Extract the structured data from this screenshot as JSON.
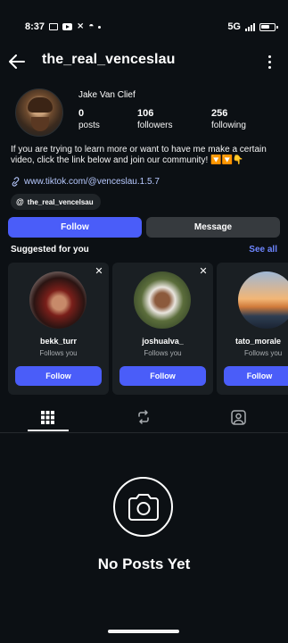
{
  "status_bar": {
    "time": "8:37",
    "network": "5G",
    "icons": [
      "notification-icon",
      "youtube-icon",
      "capcut-icon",
      "threads-icon",
      "dot-icon",
      "signal-icon",
      "battery-icon"
    ]
  },
  "header": {
    "username": "the_real_venceslau",
    "back_icon": "back-arrow-icon",
    "more_icon": "more-vertical-icon"
  },
  "profile": {
    "display_name": "Jake Van Clief",
    "stats": [
      {
        "value": "0",
        "label": "posts"
      },
      {
        "value": "106",
        "label": "followers"
      },
      {
        "value": "256",
        "label": "following"
      }
    ],
    "bio": "If you are trying to learn more or want to have me make a certain video, click the link below and join our community! 🔽🔽👇",
    "link": "www.tiktok.com/@venceslau.1.5.7",
    "threads_handle": "the_real_vencelsau"
  },
  "actions": {
    "follow_label": "Follow",
    "message_label": "Message"
  },
  "suggested": {
    "title": "Suggested for you",
    "see_all": "See all",
    "cards": [
      {
        "name": "bekk_turr",
        "subtitle": "Follows you",
        "button": "Follow"
      },
      {
        "name": "joshualva_",
        "subtitle": "Follows you",
        "button": "Follow"
      },
      {
        "name": "tato_morale",
        "subtitle": "Follows you",
        "button": "Follow"
      }
    ]
  },
  "tabs": [
    {
      "name": "grid",
      "icon": "grid-icon",
      "active": true
    },
    {
      "name": "reels",
      "icon": "repost-icon",
      "active": false
    },
    {
      "name": "tagged",
      "icon": "tagged-person-icon",
      "active": false
    }
  ],
  "empty_state": {
    "icon": "camera-icon",
    "title": "No Posts Yet"
  },
  "colors": {
    "background": "#0c1014",
    "accent": "#4a5df9",
    "link": "#b7c9ff",
    "see_all": "#6e86ff",
    "secondary_button": "#363a3e",
    "card": "#1a1f23"
  }
}
